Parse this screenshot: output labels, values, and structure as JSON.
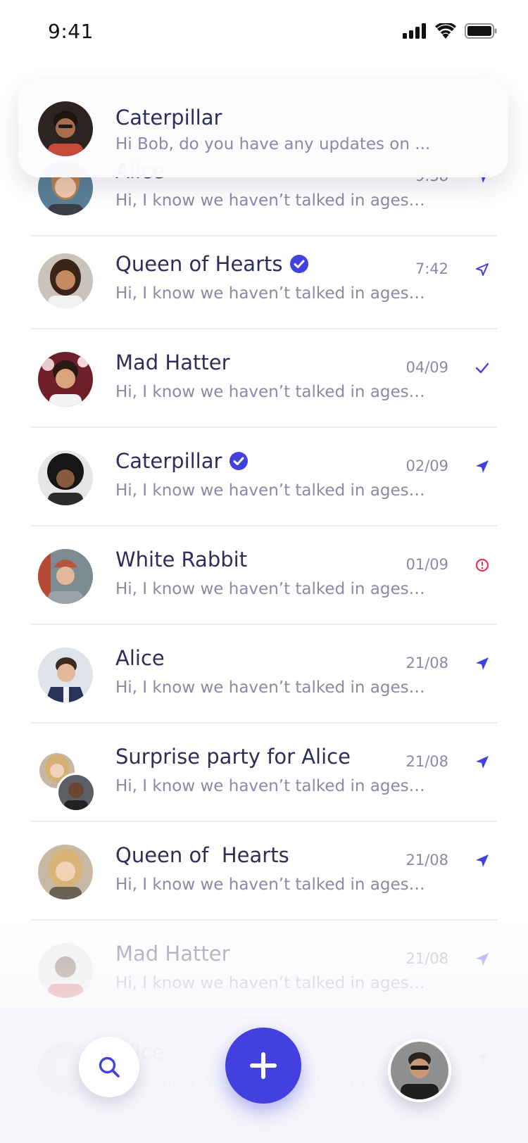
{
  "status_bar": {
    "time": "9:41"
  },
  "notification": {
    "name": "Caterpillar",
    "preview": "Hi Bob, do you have any updates on ...",
    "avatar": "avatar-photo"
  },
  "colors": {
    "accent": "#4340e0",
    "title_text": "#2f2d5a",
    "muted_text": "#8a89a8",
    "error": "#e8325a",
    "divider": "#ebebf3"
  },
  "chats": [
    {
      "name": "Alice",
      "preview": "Hi, I know we haven’t talked in ages ...",
      "time": "9:38",
      "status": "sent-filled-icon",
      "verified": false
    },
    {
      "name": "Queen of Hearts",
      "preview": "Hi, I know we haven’t talked in ages ...",
      "time": "7:42",
      "status": "sent-outline-icon",
      "verified": true
    },
    {
      "name": "Mad Hatter",
      "preview": "Hi, I know we haven’t talked in ages ...",
      "time": "04/09",
      "status": "check-icon",
      "verified": false
    },
    {
      "name": "Caterpillar",
      "preview": "Hi, I know we haven’t talked in ages ...",
      "time": "02/09",
      "status": "sent-filled-icon",
      "verified": true
    },
    {
      "name": "White Rabbit",
      "preview": "Hi, I know we haven’t talked in ages ...",
      "time": "01/09",
      "status": "error-icon",
      "verified": false
    },
    {
      "name": "Alice",
      "preview": "Hi, I know we haven’t talked in ages ...",
      "time": "21/08",
      "status": "sent-filled-icon",
      "verified": false
    },
    {
      "name": "Surprise party for Alice",
      "preview": "Hi, I know we haven’t talked in ages ...",
      "time": "21/08",
      "status": "sent-filled-icon",
      "verified": false,
      "group": true
    },
    {
      "name": "Queen of  Hearts",
      "preview": "Hi, I know we haven’t talked in ages ...",
      "time": "21/08",
      "status": "sent-filled-icon",
      "verified": false
    },
    {
      "name": "Mad Hatter",
      "preview": "Hi, I know we haven’t talked in ages ...",
      "time": "21/08",
      "status": "sent-filled-icon",
      "verified": false
    },
    {
      "name": "Alice",
      "preview": "Hi, I know we haven’t talked in ages ...",
      "time": "21/08",
      "status": "sent-filled-icon",
      "verified": false
    }
  ],
  "bottom_bar": {
    "search": "search-icon",
    "compose": "plus-icon",
    "profile": "profile-avatar"
  }
}
